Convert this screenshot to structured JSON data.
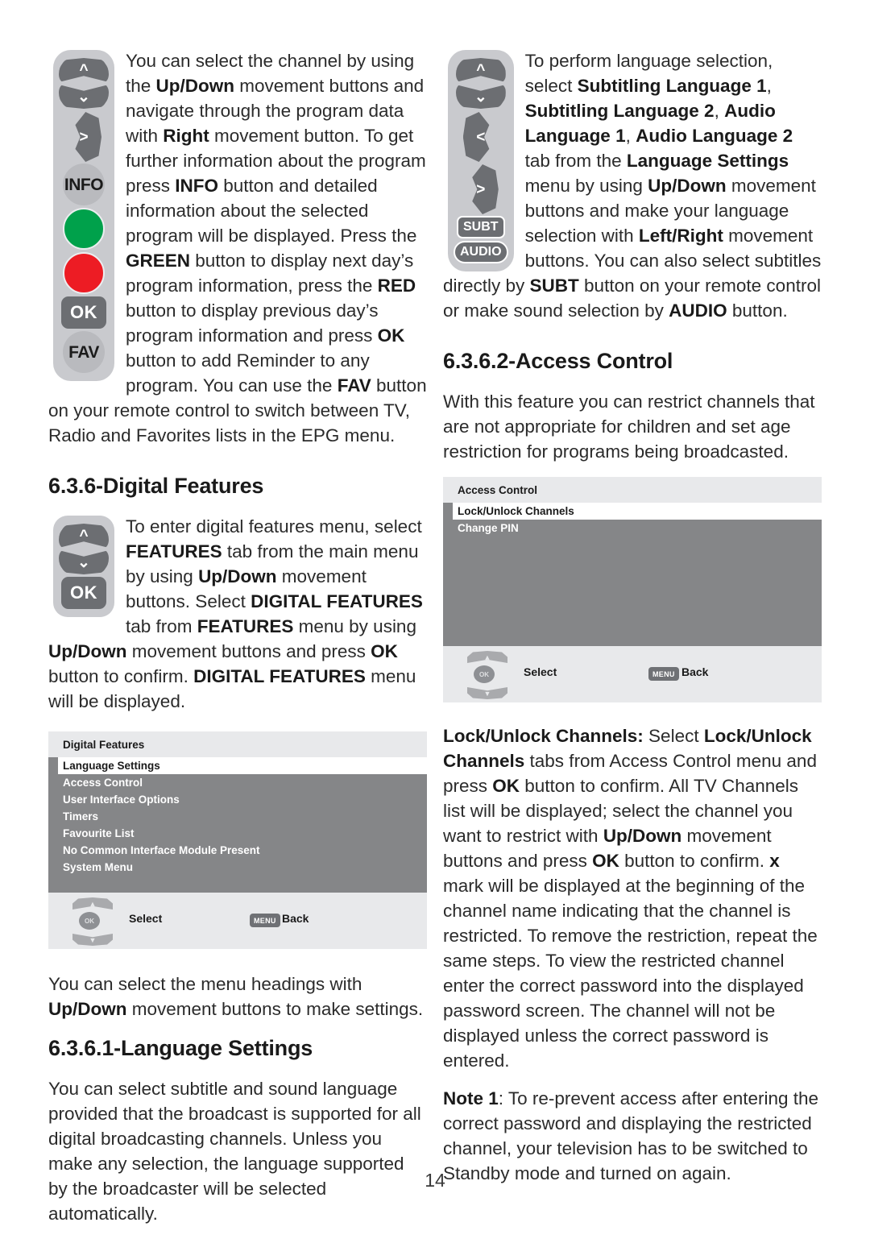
{
  "page": {
    "number": "14"
  },
  "left_column": {
    "epg_paragraph": {
      "segments": [
        {
          "t": "You can select the channel by using the ",
          "b": false
        },
        {
          "t": "Up/Down",
          "b": true
        },
        {
          "t": " movement buttons and navigate through the program data with ",
          "b": false
        },
        {
          "t": "Right",
          "b": true
        },
        {
          "t": " movement button. To get further information about the program press ",
          "b": false
        },
        {
          "t": "INFO",
          "b": true
        },
        {
          "t": " button and detailed information about the selected program will be displayed. Press the ",
          "b": false
        },
        {
          "t": "GREEN",
          "b": true
        },
        {
          "t": " button to display next day’s program information, press the ",
          "b": false
        },
        {
          "t": "RED",
          "b": true
        },
        {
          "t": " button to display previous day’s program information and press ",
          "b": false
        },
        {
          "t": "OK",
          "b": true
        },
        {
          "t": "  button to add Reminder to any program. You can use the ",
          "b": false
        },
        {
          "t": "FAV",
          "b": true
        },
        {
          "t": " button on your remote control to switch between TV, Radio and Favorites lists in the EPG menu.",
          "b": false
        }
      ]
    },
    "remote_epg": {
      "buttons": [
        "up-arrow-button",
        "down-arrow-button",
        "right-arrow-button",
        "info-button",
        "green-button",
        "red-button",
        "ok-button",
        "fav-button"
      ],
      "info_label": "INFO",
      "ok_label": "OK",
      "fav_label": "FAV"
    },
    "heading_digital_features": "6.3.6-Digital Features",
    "digital_features_paragraph": {
      "segments": [
        {
          "t": "To enter digital features menu, select ",
          "b": false
        },
        {
          "t": "FEATURES",
          "b": true
        },
        {
          "t": " tab from the main menu by using ",
          "b": false
        },
        {
          "t": "Up/Down",
          "b": true
        },
        {
          "t": " movement buttons. Select ",
          "b": false
        },
        {
          "t": "DIGITAL FEATURES",
          "b": true
        },
        {
          "t": " tab from ",
          "b": false
        },
        {
          "t": "FEATURES",
          "b": true
        },
        {
          "t": " menu by using ",
          "b": false
        },
        {
          "t": "Up/Down",
          "b": true
        },
        {
          "t": " movement buttons and press ",
          "b": false
        },
        {
          "t": "OK",
          "b": true
        },
        {
          "t": " button to confirm. ",
          "b": false
        },
        {
          "t": "DIGITAL FEATURES",
          "b": true
        },
        {
          "t": " menu will be displayed.",
          "b": false
        }
      ]
    },
    "remote_features": {
      "buttons": [
        "up-arrow-button",
        "down-arrow-button",
        "ok-button"
      ],
      "ok_label": "OK"
    },
    "tv_menu_digital_features": {
      "title": "Digital Features",
      "items": [
        {
          "label": "Language Settings",
          "selected": true
        },
        {
          "label": "Access Control",
          "selected": false
        },
        {
          "label": "User Interface Options",
          "selected": false
        },
        {
          "label": "Timers",
          "selected": false
        },
        {
          "label": "Favourite List",
          "selected": false
        },
        {
          "label": "No Common Interface Module Present",
          "selected": false
        },
        {
          "label": "System Menu",
          "selected": false
        }
      ],
      "footer": {
        "select_label": "Select",
        "back_label": "Back",
        "menu_pill": "MENU",
        "ok_pill": "OK"
      }
    },
    "menu_headings_paragraph": {
      "segments": [
        {
          "t": "You can select the menu headings with ",
          "b": false
        },
        {
          "t": "Up/Down",
          "b": true
        },
        {
          "t": " movement buttons to make settings.",
          "b": false
        }
      ]
    },
    "heading_language_settings": "6.3.6.1-Language Settings",
    "language_settings_paragraph": {
      "segments": [
        {
          "t": "You can select subtitle and sound language provided that the broadcast is supported for all digital broadcasting channels. Unless you make any selection, the language supported by the broadcaster will be selected automatically.",
          "b": false
        }
      ]
    }
  },
  "right_column": {
    "language_selection_paragraph": {
      "segments": [
        {
          "t": "To perform language selection, select ",
          "b": false
        },
        {
          "t": "Subtitling Language 1",
          "b": true
        },
        {
          "t": ", ",
          "b": false
        },
        {
          "t": "Subtitling Language 2",
          "b": true
        },
        {
          "t": ", ",
          "b": false
        },
        {
          "t": "Audio Language 1",
          "b": true
        },
        {
          "t": ", ",
          "b": false
        },
        {
          "t": "Audio Language 2",
          "b": true
        },
        {
          "t": " tab from the ",
          "b": false
        },
        {
          "t": "Language Settings",
          "b": true
        },
        {
          "t": " menu by using ",
          "b": false
        },
        {
          "t": "Up/Down",
          "b": true
        },
        {
          "t": " movement buttons and make your language selection with ",
          "b": false
        },
        {
          "t": "Left/Right",
          "b": true
        },
        {
          "t": " movement buttons. You can also select subtitles directly by ",
          "b": false
        },
        {
          "t": "SUBT",
          "b": true
        },
        {
          "t": " button on your remote control or make sound selection by ",
          "b": false
        },
        {
          "t": "AUDIO",
          "b": true
        },
        {
          "t": " button.",
          "b": false
        }
      ]
    },
    "remote_language": {
      "buttons": [
        "up-arrow-button",
        "down-arrow-button",
        "left-arrow-button",
        "right-arrow-button",
        "subt-button",
        "audio-button"
      ],
      "subt_label": "SUBT",
      "audio_label": "AUDIO"
    },
    "heading_access_control": "6.3.6.2-Access Control",
    "access_control_paragraph": {
      "segments": [
        {
          "t": "With this feature you can restrict channels that are not appropriate for children and set age restriction for programs being broadcasted.",
          "b": false
        }
      ]
    },
    "tv_menu_access_control": {
      "title": "Access Control",
      "items": [
        {
          "label": "Lock/Unlock Channels",
          "selected": true
        },
        {
          "label": "Change PIN",
          "selected": false
        }
      ],
      "footer": {
        "select_label": "Select",
        "back_label": "Back",
        "menu_pill": "MENU",
        "ok_pill": "OK"
      }
    },
    "lock_unlock_paragraph": {
      "segments": [
        {
          "t": "Lock/Unlock Channels:",
          "b": true
        },
        {
          "t": " Select ",
          "b": false
        },
        {
          "t": "Lock/Unlock Channels",
          "b": true
        },
        {
          "t": " tabs from Access Control menu and press ",
          "b": false
        },
        {
          "t": "OK",
          "b": true
        },
        {
          "t": " button to confirm. All TV Channels list will be displayed; select the channel you want to restrict with ",
          "b": false
        },
        {
          "t": "Up/Down",
          "b": true
        },
        {
          "t": " movement buttons and press ",
          "b": false
        },
        {
          "t": "OK",
          "b": true
        },
        {
          "t": " button to confirm. ",
          "b": false
        },
        {
          "t": "x",
          "b": true
        },
        {
          "t": " mark will be displayed at the beginning of the channel name indicating that the channel is restricted. To remove the restriction, repeat the same steps. To view the restricted channel enter the correct password into the displayed password screen. The channel will not be displayed unless the correct password is entered.",
          "b": false
        }
      ]
    },
    "note_paragraph": {
      "segments": [
        {
          "t": "Note 1",
          "b": true
        },
        {
          "t": ": To re-prevent access after entering the correct password and displaying the restricted channel, your television has to be switched to Standby mode and turned on again.",
          "b": false
        }
      ]
    }
  },
  "colors": {
    "remote_body": "#c9cace",
    "remote_button": "#6c6e72",
    "green_button": "#00a14b",
    "red_button": "#ed1c24",
    "menu_background": "#858688",
    "menu_chrome": "#e8e9eb"
  }
}
